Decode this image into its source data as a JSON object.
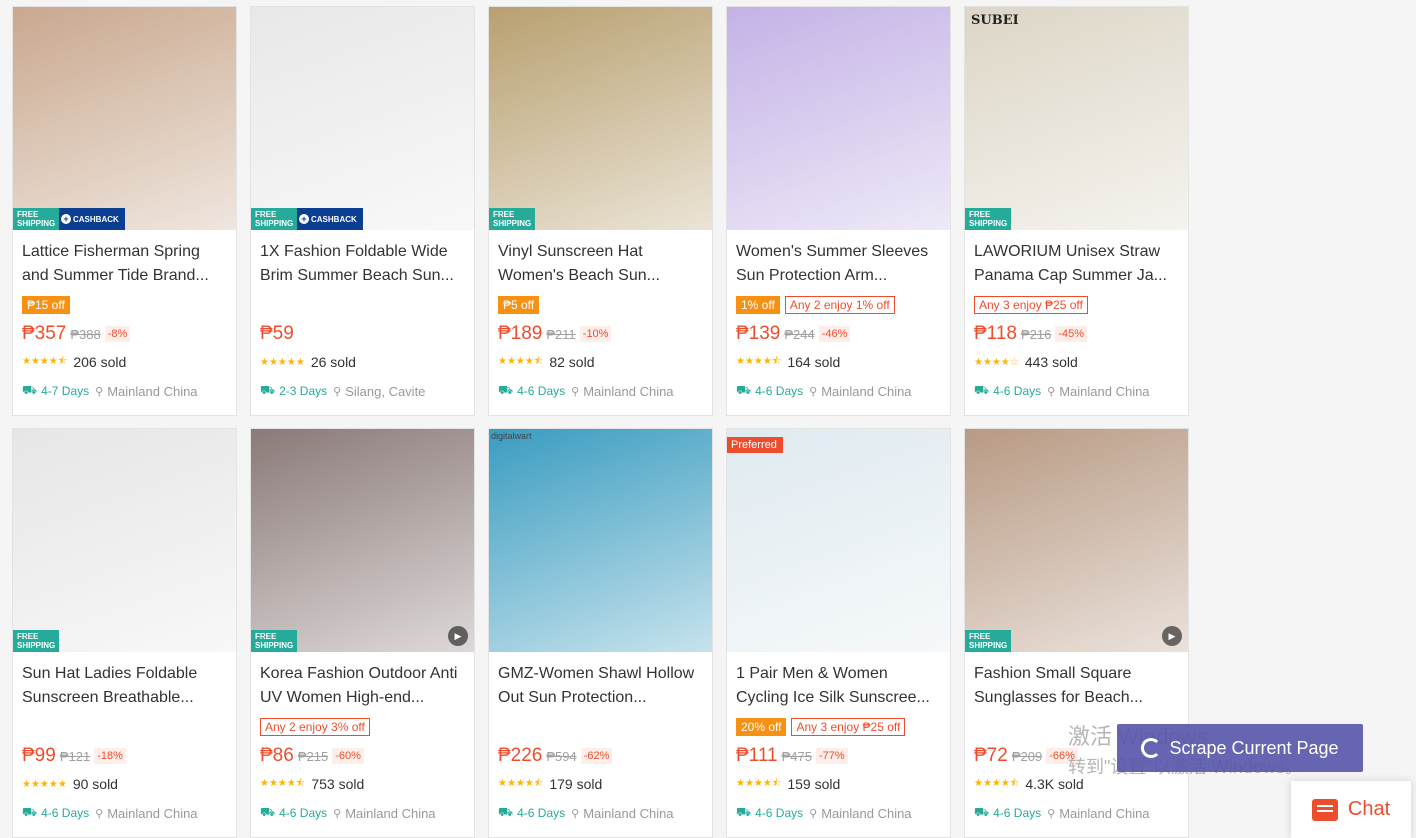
{
  "badges": {
    "free_shipping": "FREE SHIPPING",
    "cashback": "CASHBACK",
    "preferred": "Preferred"
  },
  "products": [
    {
      "title": "Lattice Fisherman Spring and Summer Tide Brand...",
      "tags": [
        {
          "type": "off",
          "text": "₱15 off"
        }
      ],
      "price": "₱357",
      "orig": "₱388",
      "disc": "-8%",
      "stars": "★★★★⯪",
      "sold": "206 sold",
      "days": "4-7 Days",
      "location": "Mainland China",
      "free": true,
      "cashback": true,
      "color": "#c9a88e"
    },
    {
      "title": "1X Fashion Foldable Wide Brim Summer Beach Sun...",
      "tags": [],
      "price": "₱59",
      "orig": "",
      "disc": "",
      "stars": "★★★★★",
      "sold": "26 sold",
      "days": "2-3 Days",
      "location": "Silang, Cavite",
      "free": true,
      "cashback": true,
      "color": "#e8e8e8"
    },
    {
      "title": "Vinyl Sunscreen Hat Women's Beach Sun...",
      "tags": [
        {
          "type": "off",
          "text": "₱5 off"
        }
      ],
      "price": "₱189",
      "orig": "₱211",
      "disc": "-10%",
      "stars": "★★★★⯪",
      "sold": "82 sold",
      "days": "4-6 Days",
      "location": "Mainland China",
      "free": true,
      "cashback": false,
      "color": "#b8a070"
    },
    {
      "title": "Women's Summer Sleeves Sun Protection Arm...",
      "tags": [
        {
          "type": "off",
          "text": "1% off"
        },
        {
          "type": "enjoy",
          "text": "Any 2 enjoy 1% off"
        }
      ],
      "price": "₱139",
      "orig": "₱244",
      "disc": "-46%",
      "stars": "★★★★⯪",
      "sold": "164 sold",
      "days": "4-6 Days",
      "location": "Mainland China",
      "free": false,
      "cashback": false,
      "color": "#c4b2e6"
    },
    {
      "title": "LAWORIUM Unisex Straw Panama Cap Summer Ja...",
      "tags": [
        {
          "type": "enjoy",
          "text": "Any 3 enjoy ₱25 off"
        }
      ],
      "price": "₱118",
      "orig": "₱216",
      "disc": "-45%",
      "stars": "★★★★☆",
      "sold": "443 sold",
      "days": "4-6 Days",
      "location": "Mainland China",
      "free": true,
      "cashback": false,
      "color": "#ddd6c6",
      "logo": "SUBEI"
    },
    {
      "title": "Sun Hat Ladies Foldable Sunscreen Breathable...",
      "tags": [],
      "price": "₱99",
      "orig": "₱121",
      "disc": "-18%",
      "stars": "★★★★★",
      "sold": "90 sold",
      "days": "4-6 Days",
      "location": "Mainland China",
      "free": true,
      "cashback": false,
      "color": "#e6e6e6"
    },
    {
      "title": "Korea Fashion Outdoor Anti UV Women High-end...",
      "tags": [
        {
          "type": "enjoy",
          "text": "Any 2 enjoy 3% off"
        }
      ],
      "price": "₱86",
      "orig": "₱215",
      "disc": "-60%",
      "stars": "★★★★⯪",
      "sold": "753 sold",
      "days": "4-6 Days",
      "location": "Mainland China",
      "free": true,
      "cashback": false,
      "color": "#8a7a78",
      "play": true
    },
    {
      "title": "GMZ-Women Shawl Hollow Out Sun Protection...",
      "tags": [],
      "price": "₱226",
      "orig": "₱594",
      "disc": "-62%",
      "stars": "★★★★⯪",
      "sold": "179 sold",
      "days": "4-6 Days",
      "location": "Mainland China",
      "free": false,
      "cashback": false,
      "color": "#3a9cc0",
      "corner": "digitalwart"
    },
    {
      "title": "1 Pair Men & Women Cycling Ice Silk Sunscree...",
      "tags": [
        {
          "type": "off",
          "text": "20% off"
        },
        {
          "type": "enjoy",
          "text": "Any 3 enjoy ₱25 off"
        }
      ],
      "price": "₱111",
      "orig": "₱475",
      "disc": "-77%",
      "stars": "★★★★⯪",
      "sold": "159 sold",
      "days": "4-6 Days",
      "location": "Mainland China",
      "free": false,
      "cashback": false,
      "color": "#dfeaf0",
      "preferred": true
    },
    {
      "title": "Fashion Small Square Sunglasses for Beach...",
      "tags": [],
      "price": "₱72",
      "orig": "₱209",
      "disc": "-66%",
      "stars": "★★★★⯪",
      "sold": "4.3K sold",
      "days": "4-6 Days",
      "location": "Mainland China",
      "free": true,
      "cashback": false,
      "color": "#b89a84",
      "play": true
    }
  ],
  "scrape_button": "Scrape Current Page",
  "watermark": {
    "line1": "激活 Windows",
    "line2": "转到\"设置\"以激活 Windows。"
  },
  "chat_button": "Chat",
  "colors": {
    "accent": "#ee4d2d",
    "shipping": "#26aa99",
    "star": "#ffb400"
  }
}
